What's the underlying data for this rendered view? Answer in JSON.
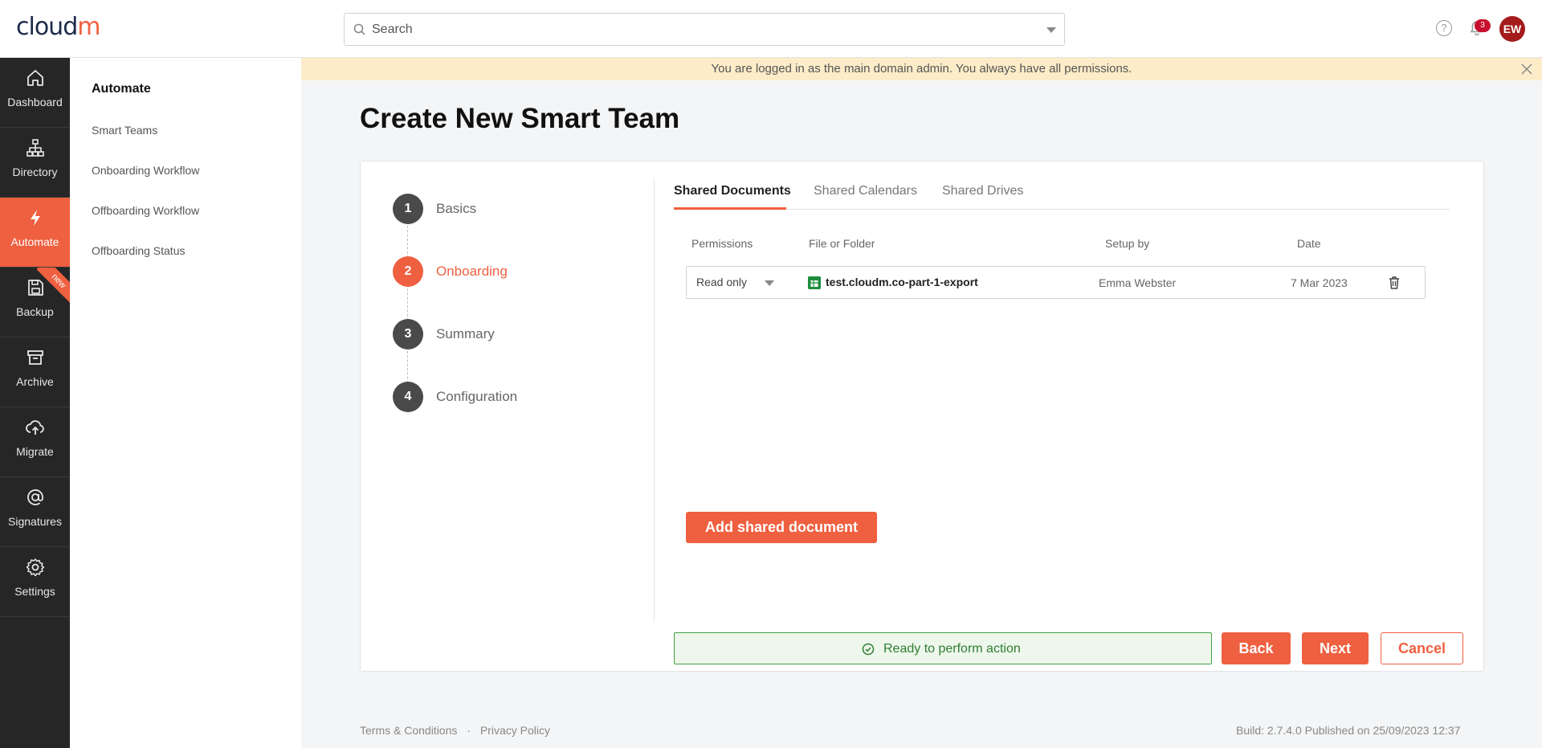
{
  "app": {
    "logo_text": "cloud",
    "logo_accent": "m",
    "brand_color": "#ef6040"
  },
  "search": {
    "placeholder": "Search"
  },
  "header": {
    "notifications_count": "3",
    "user_initials": "EW"
  },
  "rail": {
    "items": [
      {
        "label": "Dashboard",
        "icon": "home-icon"
      },
      {
        "label": "Directory",
        "icon": "org-chart-icon"
      },
      {
        "label": "Automate",
        "icon": "lightning-icon",
        "active": true
      },
      {
        "label": "Backup",
        "icon": "save-icon",
        "ribbon": "new"
      },
      {
        "label": "Archive",
        "icon": "archive-box-icon"
      },
      {
        "label": "Migrate",
        "icon": "cloud-upload-icon"
      },
      {
        "label": "Signatures",
        "icon": "at-sign-icon"
      },
      {
        "label": "Settings",
        "icon": "gear-icon"
      }
    ]
  },
  "subnav": {
    "title": "Automate",
    "items": [
      "Smart Teams",
      "Onboarding Workflow",
      "Offboarding Workflow",
      "Offboarding Status"
    ]
  },
  "banner": {
    "text": "You are logged in as the main domain admin. You always have all permissions."
  },
  "page": {
    "title": "Create New Smart Team"
  },
  "steps": [
    {
      "num": "1",
      "label": "Basics"
    },
    {
      "num": "2",
      "label": "Onboarding",
      "active": true
    },
    {
      "num": "3",
      "label": "Summary"
    },
    {
      "num": "4",
      "label": "Configuration"
    }
  ],
  "tabs": [
    {
      "label": "Shared Documents",
      "active": true
    },
    {
      "label": "Shared Calendars"
    },
    {
      "label": "Shared Drives"
    }
  ],
  "table": {
    "headers": [
      "Permissions",
      "File or Folder",
      "Setup by",
      "Date"
    ],
    "rows": [
      {
        "permission": "Read only",
        "file": "test.cloudm.co-part-1-export",
        "setup_by": "Emma Webster",
        "date": "7 Mar 2023"
      }
    ]
  },
  "actions": {
    "add_label": "Add shared document",
    "status": "Ready to perform action",
    "back": "Back",
    "next": "Next",
    "cancel": "Cancel"
  },
  "footer": {
    "terms": "Terms & Conditions",
    "separator": "·",
    "privacy": "Privacy Policy",
    "build": "Build: 2.7.4.0 Published on 25/09/2023 12:37"
  }
}
